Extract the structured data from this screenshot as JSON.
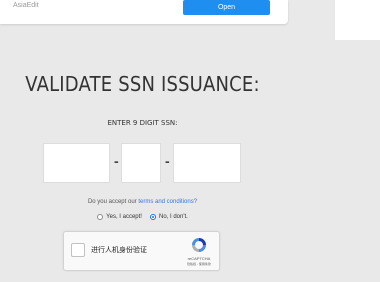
{
  "ad": {
    "brand": "AsiaEdit",
    "open_label": "Open"
  },
  "form": {
    "title": "VALIDATE SSN ISSUANCE:",
    "subtitle": "ENTER 9 DIGIT SSN:",
    "ssn_part1": "",
    "ssn_part2": "",
    "ssn_part3": "",
    "dash": "-",
    "consent_prefix": "Do you accept our ",
    "consent_link": "terms and conditions?",
    "radio_yes": "Yes, I accept!",
    "radio_no": "No, I don't.",
    "selected": "No, I don't."
  },
  "recaptcha": {
    "label": "进行人机身份验证",
    "brand": "reCAPTCHA",
    "terms": "隐私权 - 使用条款"
  },
  "colors": {
    "accent": "#1f8ef1",
    "background": "#e9e9e9",
    "link": "#3b74d6"
  }
}
